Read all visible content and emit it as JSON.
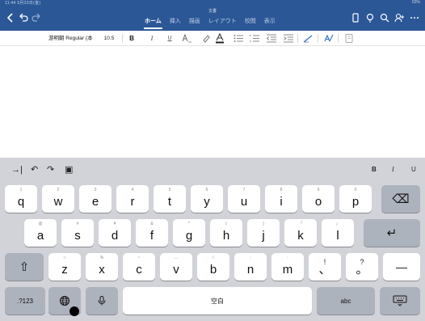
{
  "statusbar": {
    "left": "11:44 5月23日(金)",
    "right": "63%"
  },
  "document": {
    "title": "文書"
  },
  "titlebar": {
    "left_icons": [
      "chevron-left-icon",
      "undo-icon",
      "redo-icon"
    ],
    "right_icons": [
      "phone-icon",
      "lightbulb-icon",
      "search-icon",
      "share-icon",
      "more-icon"
    ]
  },
  "tabs": [
    "ホーム",
    "挿入",
    "描画",
    "レイアウト",
    "校閲",
    "表示"
  ],
  "ribbon": {
    "font_name": "游明朝 Regular (本",
    "font_size": "10.5",
    "bold": "B",
    "italic": "I",
    "underline": "U",
    "font_color": "A"
  },
  "kb_toolbar": {
    "left": [
      "→|",
      "↶",
      "↷",
      "▣"
    ],
    "right": [
      "B",
      "I",
      "U"
    ]
  },
  "keyboard": {
    "row1": [
      {
        "main": "q",
        "hint": "1"
      },
      {
        "main": "w",
        "hint": "2"
      },
      {
        "main": "e",
        "hint": "3"
      },
      {
        "main": "r",
        "hint": "4"
      },
      {
        "main": "t",
        "hint": "5"
      },
      {
        "main": "y",
        "hint": "6"
      },
      {
        "main": "u",
        "hint": "7"
      },
      {
        "main": "i",
        "hint": "8"
      },
      {
        "main": "o",
        "hint": "9"
      },
      {
        "main": "p",
        "hint": "0"
      }
    ],
    "row2": [
      {
        "main": "a",
        "hint": "@"
      },
      {
        "main": "s",
        "hint": "#"
      },
      {
        "main": "d",
        "hint": "¥"
      },
      {
        "main": "f",
        "hint": "&"
      },
      {
        "main": "g",
        "hint": "*"
      },
      {
        "main": "h",
        "hint": "("
      },
      {
        "main": "j",
        "hint": ")"
      },
      {
        "main": "k",
        "hint": "「"
      },
      {
        "main": "l",
        "hint": "」"
      }
    ],
    "row3": [
      {
        "main": "z",
        "hint": "☆"
      },
      {
        "main": "x",
        "hint": "%"
      },
      {
        "main": "c",
        "hint": "~"
      },
      {
        "main": "v",
        "hint": "…"
      },
      {
        "main": "b",
        "hint": "/"
      },
      {
        "main": "n",
        "hint": ";"
      },
      {
        "main": "m",
        "hint": ":"
      },
      {
        "main": "、",
        "hint": "!"
      },
      {
        "main": "。",
        "hint": "?"
      }
    ],
    "delete": "⌫",
    "return": "↵",
    "shift": "⇧",
    "dash": "—",
    "numbers": ".?123",
    "globe": "globe-icon",
    "mic": "mic-icon",
    "space": "空白",
    "abc": "abc",
    "hide": "keyboard-hide-icon"
  }
}
